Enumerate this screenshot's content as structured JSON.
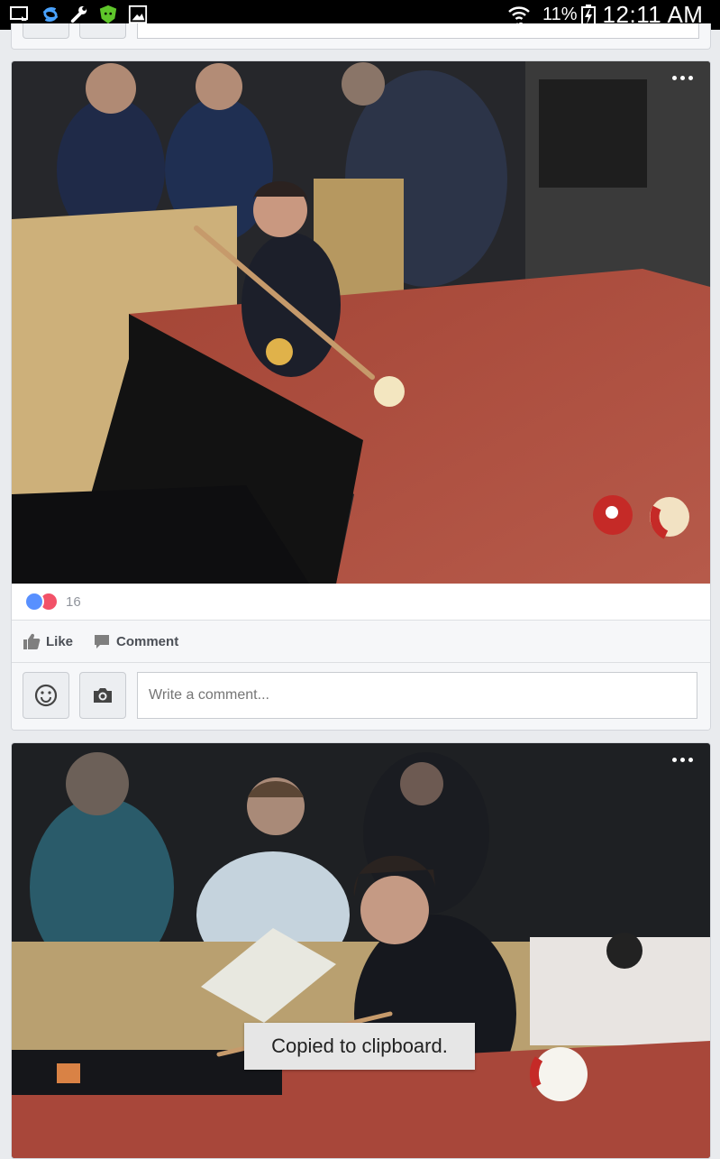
{
  "status_bar": {
    "battery": "11%",
    "time": "12:11 AM"
  },
  "posts": [
    {
      "reaction_count": "16",
      "like_label": "Like",
      "comment_label": "Comment",
      "comment_placeholder": "Write a comment..."
    },
    {}
  ],
  "toast": {
    "message": "Copied to clipboard."
  },
  "colors": {
    "like_blue": "#5890ff",
    "love_red": "#f25268",
    "felt": "#a8473a"
  },
  "icons": [
    "screen-cast-icon",
    "sync-icon",
    "wrench-icon",
    "android-shield-icon",
    "image-icon",
    "wifi-icon",
    "battery-charging-icon",
    "more-icon",
    "like-reaction-icon",
    "love-reaction-icon",
    "thumbs-up-icon",
    "comment-bubble-icon",
    "emoji-icon",
    "camera-icon"
  ]
}
